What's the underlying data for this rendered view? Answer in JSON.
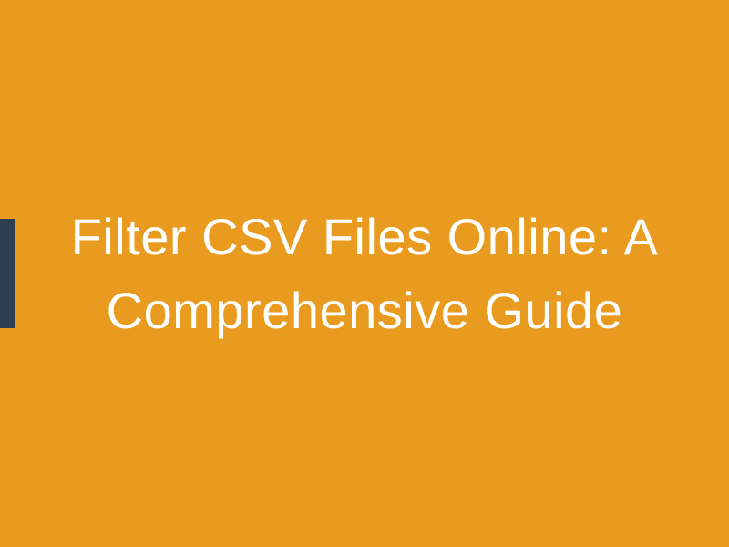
{
  "title": "Filter CSV Files Online: A Comprehensive Guide",
  "colors": {
    "background": "#e89b1e",
    "text": "#ffffff",
    "accent": "#2c3e50"
  }
}
